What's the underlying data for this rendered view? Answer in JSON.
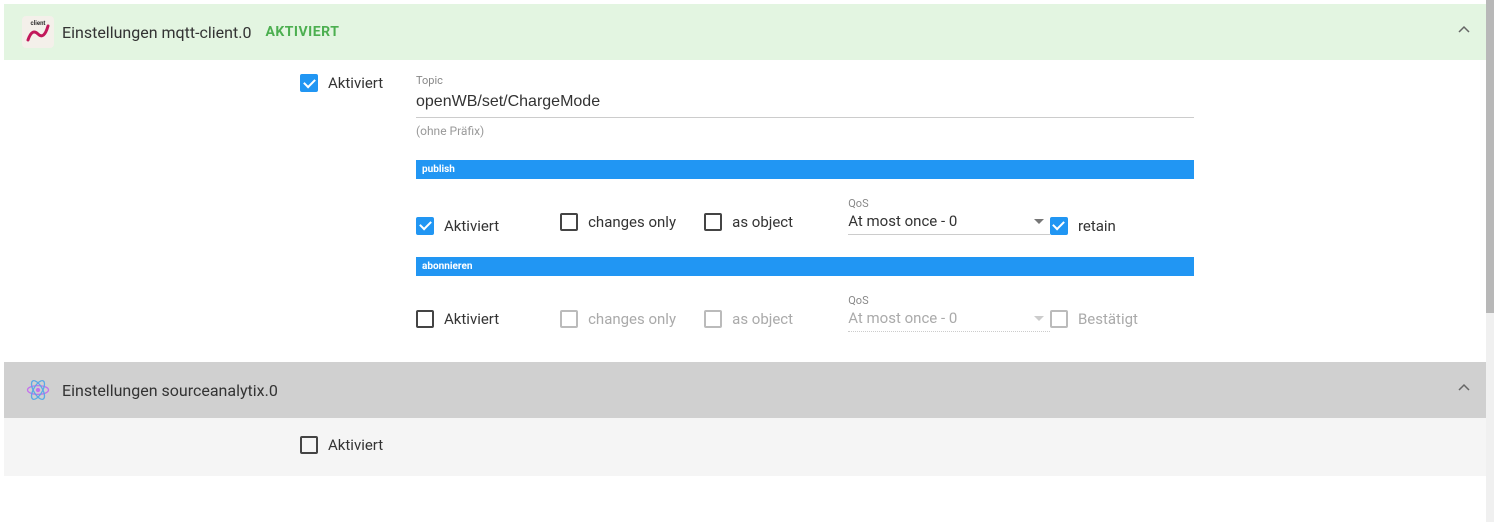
{
  "panels": {
    "mqtt": {
      "title": "Einstellungen mqtt-client.0",
      "status": "AKTIVIERT",
      "enabled_label": "Aktiviert",
      "topic_label": "Topic",
      "topic_value": "openWB/set/ChargeMode",
      "topic_helper": "(ohne Präfix)",
      "publish_section": "publish",
      "subscribe_section": "abonnieren",
      "publish": {
        "enabled": "Aktiviert",
        "changes_only": "changes only",
        "as_object": "as object",
        "qos_label": "QoS",
        "qos_value": "At most once - 0",
        "retain": "retain"
      },
      "subscribe": {
        "enabled": "Aktiviert",
        "changes_only": "changes only",
        "as_object": "as object",
        "qos_label": "QoS",
        "qos_value": "At most once - 0",
        "confirmed": "Bestätigt"
      }
    },
    "sourceanalytix": {
      "title": "Einstellungen sourceanalytix.0",
      "enabled_label": "Aktiviert"
    }
  }
}
